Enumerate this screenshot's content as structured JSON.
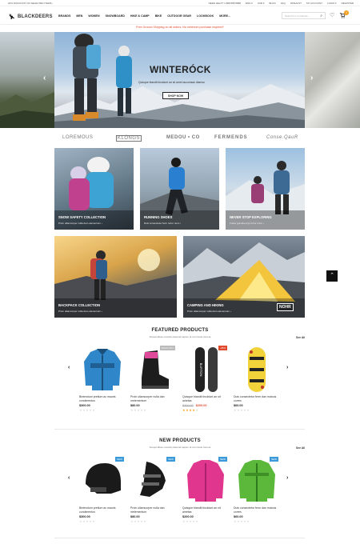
{
  "topbar": {
    "left": "20% DISCOUNT ON SELECTED ITEMS ›",
    "right": [
      "NEED HELP? 1 888 888 8888",
      "ENG ▾",
      "USD ▾",
      "BLOG",
      "FAQ",
      "WISHLIST",
      "MY ACCOUNT",
      "LOGIN ▾",
      "REGISTER"
    ]
  },
  "header": {
    "logo": "BLACKDEERS",
    "nav": [
      "BRANDS",
      "MEN",
      "WOMEN",
      "SNOWBOARD",
      "HIKE & CAMP",
      "BIKE",
      "OUTDOOR GEAR",
      "LOOKBOOK",
      "MORE..."
    ],
    "search_placeholder": "Search for a products...",
    "cart_count": "0"
  },
  "promo": "Free Ground Shipping on all orders. No minimum purchase required*",
  "hero": {
    "title": "WINTERÓCK",
    "subtitle": "Quisque blandit tincidunt an sit amet accumsan diamso",
    "button": "SHOP NOW"
  },
  "brands": [
    "LOREMOUS",
    "KLÖNGS",
    "MEDOU • CO",
    "FERMENDS",
    "Conse.QauR"
  ],
  "tiles": [
    {
      "title": "SNOW SAFETY COLLECTION",
      "sub": "Proin ullamcorper nulla dam elementum ›"
    },
    {
      "title": "RUNNING SHOES",
      "sub": "Duis consectetur ferm tortor nunc ›"
    },
    {
      "title": "NEVER STOP EXPLORING",
      "sub": "Fusce gravida ergo tortor nunc ›"
    },
    {
      "title": "BACKPACK COLLECTION",
      "sub": "Proin ullamcorper nulla dam elementum ›"
    },
    {
      "title": "CAMPING AND HIKING",
      "sub": "Proin ullamcorper nulla dam elementum ›"
    }
  ],
  "nohr_logo": "NOHR",
  "featured": {
    "title": "FEATURED PRODUCTS",
    "subtitle": "Suspendisse maculis placerat sapien at commodo lorema",
    "see_all": "See All",
    "products": [
      {
        "name": "Bintendum pretium ac mauris condimentus",
        "price": "$300.00",
        "old": "",
        "badge": "",
        "badge_color": ""
      },
      {
        "name": "Proin ullamcorper nulla dan melementum",
        "price": "$80.00",
        "old": "",
        "badge": "SOLD OUT",
        "badge_color": "#bbbbbb"
      },
      {
        "name": "Quisque blandit tincidunt an sit ametas",
        "price": "$200.00",
        "old": "$300.00",
        "badge": "-25%",
        "badge_color": "#e24a2e"
      },
      {
        "name": "Duis consectetur ferm dan mutous corres",
        "price": "$60.00",
        "old": "",
        "badge": "",
        "badge_color": ""
      }
    ],
    "ratings": [
      0,
      0,
      4,
      0
    ]
  },
  "newp": {
    "title": "NEW PRODUCTS",
    "subtitle": "Suspendisse maculis placerat sapien at commodo lorema",
    "see_all": "See All",
    "products": [
      {
        "name": "Bintendum pretium ac mauris condimentus",
        "price": "$300.00",
        "badge": "NEW"
      },
      {
        "name": "Proin ullamcorper nulla dan melementum",
        "price": "$80.00",
        "badge": "NEW"
      },
      {
        "name": "Quisque blandit tincidunt an sit ametas",
        "price": "$200.00",
        "badge": "NEW"
      },
      {
        "name": "Duis consectetur ferm dan mutous corres",
        "price": "$60.00",
        "badge": "NEW"
      }
    ]
  },
  "colors": {
    "accent": "#e24a2e",
    "badge_new": "#3a9ad9",
    "cart": "#f39c12"
  }
}
